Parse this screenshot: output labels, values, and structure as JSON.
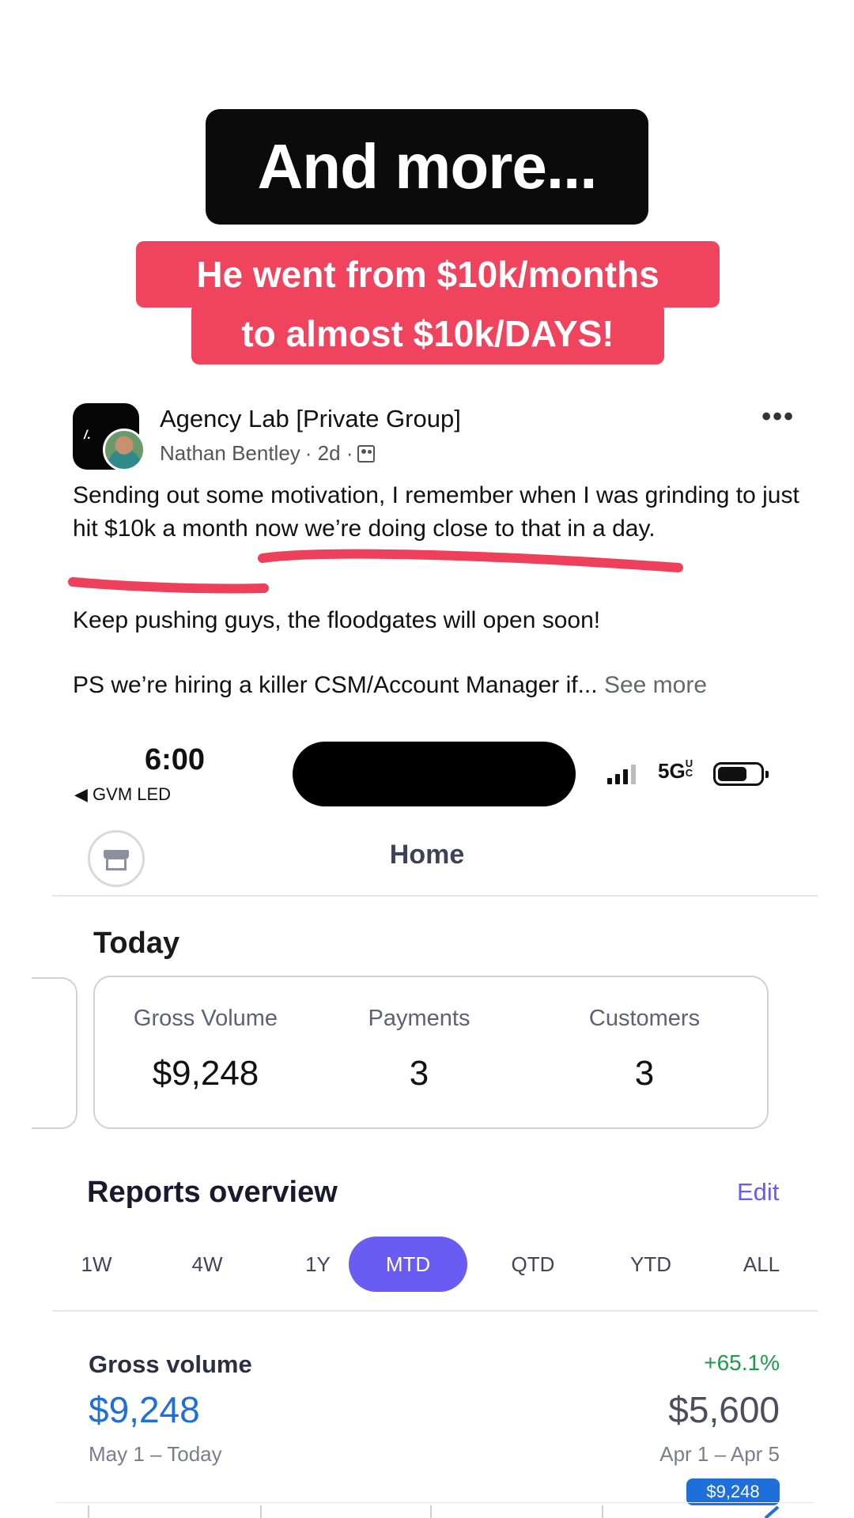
{
  "overlay": {
    "headline": "And more...",
    "subline1": "He went from $10k/months",
    "subline2": "to almost $10k/DAYS!"
  },
  "post": {
    "group_name": "Agency Lab [Private Group]",
    "author": "Nathan Bentley",
    "time": "· 2d ·",
    "paragraph1": "Sending out some motivation, I remember when I was grinding to just hit $10k a month now we’re doing close to that in a day.",
    "paragraph2": "Keep pushing guys, the floodgates will open soon!",
    "paragraph3": "PS we’re hiring a killer CSM/Account Manager if...",
    "see_more": "See more",
    "more_icon": "•••",
    "underline_color": "#ee3f5b"
  },
  "status_bar": {
    "time": "6:00",
    "back_app": "◀ GVM LED",
    "network": "5G",
    "network_suffix": "UC"
  },
  "app": {
    "title": "Home",
    "today_label": "Today",
    "stats": [
      {
        "label": "Gross Volume",
        "value": "$9,248"
      },
      {
        "label": "Payments",
        "value": "3"
      },
      {
        "label": "Customers",
        "value": "3"
      }
    ],
    "reports_title": "Reports overview",
    "edit_label": "Edit",
    "periods": [
      "1W",
      "4W",
      "1Y",
      "MTD",
      "QTD",
      "YTD",
      "ALL"
    ],
    "active_period": "MTD",
    "accent_color": "#6a5cf2",
    "gross_volume": {
      "label": "Gross volume",
      "value": "$9,248",
      "range": "May 1 – Today",
      "change": "+65.1%",
      "previous_value": "$5,600",
      "previous_range": "Apr 1 – Apr 5",
      "tooltip": "$9,248"
    }
  }
}
